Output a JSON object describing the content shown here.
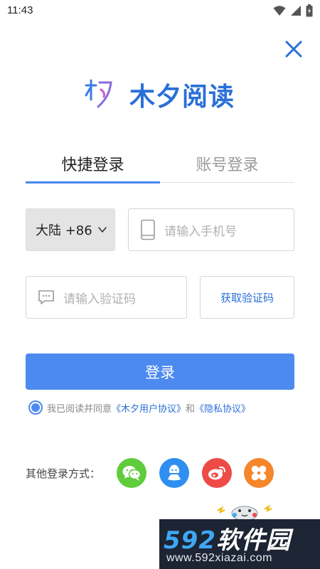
{
  "status_bar": {
    "time": "11:43",
    "icons": [
      "wifi-icon",
      "signal-icon",
      "battery-icon"
    ]
  },
  "close_icon": "close-icon",
  "logo": {
    "text": "木夕阅读",
    "mark_icon": "muxi-logo-mark",
    "color": "#2a6fd8"
  },
  "tabs": [
    {
      "label": "快捷登录",
      "active": true
    },
    {
      "label": "账号登录",
      "active": false
    }
  ],
  "form": {
    "region": "大陆 +86",
    "phone_placeholder": "请输入手机号",
    "code_placeholder": "请输入验证码",
    "get_code_label": "获取验证码",
    "login_label": "登录"
  },
  "agreement": {
    "checked": true,
    "prefix": "我已阅读并同意",
    "user_agreement": "《木夕用户协议》",
    "and": "和",
    "privacy": "《隐私协议》"
  },
  "other_login": {
    "label": "其他登录方式：",
    "methods": [
      "wechat-icon",
      "qq-icon",
      "weibo-icon",
      "pinwheel-icon"
    ]
  },
  "watermark": {
    "number": "592",
    "title": "软件园",
    "url": "www.592xiazai.com"
  },
  "colors": {
    "accent": "#4d8af0",
    "link": "#2a6fd8",
    "wechat": "#5fcc3b",
    "qq": "#2e8ff0",
    "weibo": "#ee4b46",
    "other": "#f5862a"
  }
}
